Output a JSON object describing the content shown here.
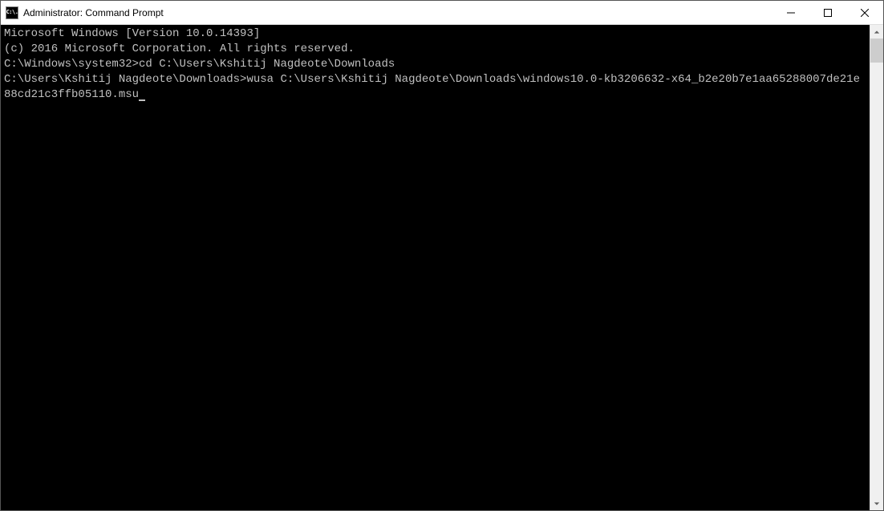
{
  "window": {
    "title": "Administrator: Command Prompt",
    "icon_text": "C:\\."
  },
  "terminal": {
    "line1": "Microsoft Windows [Version 10.0.14393]",
    "line2": "(c) 2016 Microsoft Corporation. All rights reserved.",
    "blank1": "",
    "prompt1": "C:\\Windows\\system32>",
    "cmd1": "cd C:\\Users\\Kshitij Nagdeote\\Downloads",
    "blank2": "",
    "prompt2": "C:\\Users\\Kshitij Nagdeote\\Downloads>",
    "cmd2": "wusa C:\\Users\\Kshitij Nagdeote\\Downloads\\windows10.0-kb3206632-x64_b2e20b7e1aa65288007de21e88cd21c3ffb05110.msu"
  }
}
